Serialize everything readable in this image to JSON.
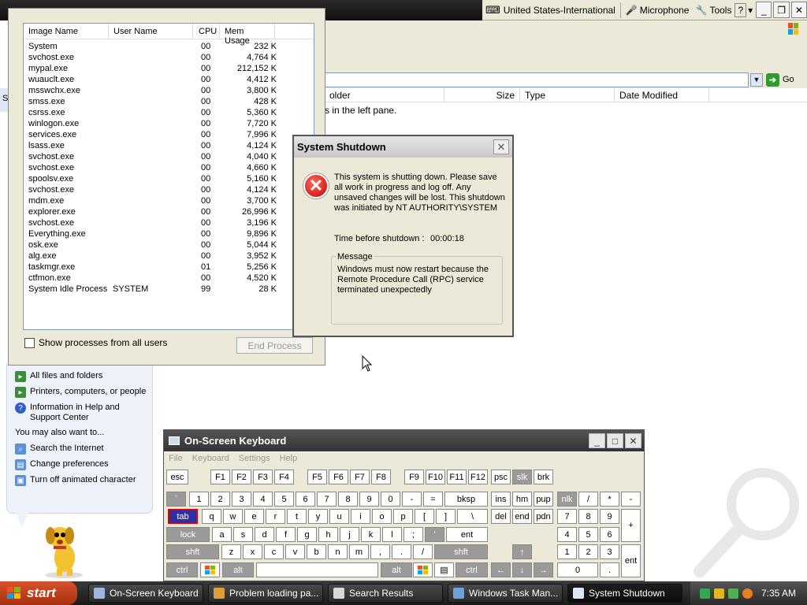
{
  "langbar": {
    "language": "United States-International",
    "microphone": "Microphone",
    "tools": "Tools",
    "help": "?"
  },
  "search_results": {
    "go_label": "Go",
    "columns": [
      "older",
      "Size",
      "Type",
      "Date Modified"
    ],
    "hint": "s in the left pane.",
    "left_letter": "S"
  },
  "assistant": {
    "items": [
      {
        "label": "All files and folders",
        "icon": "search-folder-icon"
      },
      {
        "label": "Printers, computers, or people",
        "icon": "printer-icon"
      },
      {
        "label": "Information in Help and Support Center",
        "icon": "help-icon"
      }
    ],
    "also_heading": "You may also want to...",
    "also_items": [
      {
        "label": "Search the Internet",
        "icon": "internet-search-icon"
      },
      {
        "label": "Change preferences",
        "icon": "preferences-icon"
      },
      {
        "label": "Turn off animated character",
        "icon": "character-icon"
      }
    ]
  },
  "task_manager": {
    "columns": [
      "Image Name",
      "User Name",
      "CPU",
      "Mem Usage"
    ],
    "rows": [
      {
        "name": "System",
        "user": "",
        "cpu": "00",
        "mem": "232 K"
      },
      {
        "name": "svchost.exe",
        "user": "",
        "cpu": "00",
        "mem": "4,764 K"
      },
      {
        "name": "mypal.exe",
        "user": "",
        "cpu": "00",
        "mem": "212,152 K"
      },
      {
        "name": "wuauclt.exe",
        "user": "",
        "cpu": "00",
        "mem": "4,412 K"
      },
      {
        "name": "msswchx.exe",
        "user": "",
        "cpu": "00",
        "mem": "3,800 K"
      },
      {
        "name": "smss.exe",
        "user": "",
        "cpu": "00",
        "mem": "428 K"
      },
      {
        "name": "csrss.exe",
        "user": "",
        "cpu": "00",
        "mem": "5,360 K"
      },
      {
        "name": "winlogon.exe",
        "user": "",
        "cpu": "00",
        "mem": "7,720 K"
      },
      {
        "name": "services.exe",
        "user": "",
        "cpu": "00",
        "mem": "7,996 K"
      },
      {
        "name": "lsass.exe",
        "user": "",
        "cpu": "00",
        "mem": "4,124 K"
      },
      {
        "name": "svchost.exe",
        "user": "",
        "cpu": "00",
        "mem": "4,040 K"
      },
      {
        "name": "svchost.exe",
        "user": "",
        "cpu": "00",
        "mem": "4,660 K"
      },
      {
        "name": "spoolsv.exe",
        "user": "",
        "cpu": "00",
        "mem": "5,160 K"
      },
      {
        "name": "svchost.exe",
        "user": "",
        "cpu": "00",
        "mem": "4,124 K"
      },
      {
        "name": "mdm.exe",
        "user": "",
        "cpu": "00",
        "mem": "3,700 K"
      },
      {
        "name": "explorer.exe",
        "user": "",
        "cpu": "00",
        "mem": "26,996 K"
      },
      {
        "name": "svchost.exe",
        "user": "",
        "cpu": "00",
        "mem": "3,196 K"
      },
      {
        "name": "Everything.exe",
        "user": "",
        "cpu": "00",
        "mem": "9,896 K"
      },
      {
        "name": "osk.exe",
        "user": "",
        "cpu": "00",
        "mem": "5,044 K"
      },
      {
        "name": "alg.exe",
        "user": "",
        "cpu": "00",
        "mem": "3,952 K"
      },
      {
        "name": "taskmgr.exe",
        "user": "",
        "cpu": "01",
        "mem": "5,256 K"
      },
      {
        "name": "ctfmon.exe",
        "user": "",
        "cpu": "00",
        "mem": "4,520 K"
      },
      {
        "name": "System Idle Process",
        "user": "SYSTEM",
        "cpu": "99",
        "mem": "28 K"
      }
    ],
    "show_all_label": "Show processes from all users",
    "end_process_label": "End Process"
  },
  "shutdown_dialog": {
    "title": "System Shutdown",
    "body": "This system is shutting down. Please save all work in progress and log off. Any unsaved changes will be lost. This shutdown was initiated by NT AUTHORITY\\SYSTEM",
    "time_label": "Time before shutdown :",
    "time_value": "00:00:18",
    "message_label": "Message",
    "message_text": "Windows must now restart because the Remote Procedure Call (RPC) service terminated unexpectedly"
  },
  "osk": {
    "title": "On-Screen Keyboard",
    "menu": [
      "File",
      "Keyboard",
      "Settings",
      "Help"
    ],
    "keys": [
      [
        "esc",
        211,
        596,
        28,
        "n"
      ],
      [
        "F1",
        267,
        596,
        25,
        "n"
      ],
      [
        "F2",
        294,
        596,
        25,
        "n"
      ],
      [
        "F3",
        321,
        596,
        25,
        "n"
      ],
      [
        "F4",
        348,
        596,
        25,
        "n"
      ],
      [
        "F5",
        390,
        596,
        25,
        "n"
      ],
      [
        "F6",
        417,
        596,
        25,
        "n"
      ],
      [
        "F7",
        444,
        596,
        25,
        "n"
      ],
      [
        "F8",
        471,
        596,
        25,
        "n"
      ],
      [
        "F9",
        513,
        596,
        25,
        "n"
      ],
      [
        "F10",
        540,
        596,
        25,
        "n"
      ],
      [
        "F11",
        567,
        596,
        25,
        "n"
      ],
      [
        "F12",
        594,
        596,
        25,
        "n"
      ],
      [
        "psc",
        623,
        596,
        25,
        "n"
      ],
      [
        "slk",
        650,
        596,
        25,
        "dim"
      ],
      [
        "brk",
        677,
        596,
        25,
        "n"
      ],
      [
        "`",
        211,
        624,
        25,
        "dim"
      ],
      [
        "1",
        240,
        624,
        25,
        "n"
      ],
      [
        "2",
        267,
        624,
        25,
        "n"
      ],
      [
        "3",
        294,
        624,
        25,
        "n"
      ],
      [
        "4",
        321,
        624,
        25,
        "n"
      ],
      [
        "5",
        348,
        624,
        25,
        "n"
      ],
      [
        "6",
        375,
        624,
        25,
        "n"
      ],
      [
        "7",
        402,
        624,
        25,
        "n"
      ],
      [
        "8",
        429,
        624,
        25,
        "n"
      ],
      [
        "9",
        456,
        624,
        25,
        "n"
      ],
      [
        "0",
        483,
        624,
        25,
        "n"
      ],
      [
        "-",
        510,
        624,
        25,
        "n"
      ],
      [
        "=",
        537,
        624,
        25,
        "n"
      ],
      [
        "bksp",
        564,
        624,
        55,
        "n"
      ],
      [
        "ins",
        623,
        624,
        25,
        "n"
      ],
      [
        "hm",
        650,
        624,
        25,
        "n"
      ],
      [
        "pup",
        677,
        624,
        25,
        "n"
      ],
      [
        "nlk",
        707,
        624,
        25,
        "dim"
      ],
      [
        "/",
        734,
        624,
        25,
        "n"
      ],
      [
        "*",
        761,
        624,
        25,
        "n"
      ],
      [
        "-",
        788,
        624,
        25,
        "n"
      ],
      [
        "tab",
        213,
        646,
        38,
        "sel"
      ],
      [
        "q",
        256,
        646,
        25,
        "n"
      ],
      [
        "w",
        283,
        646,
        25,
        "n"
      ],
      [
        "e",
        310,
        646,
        25,
        "n"
      ],
      [
        "r",
        337,
        646,
        25,
        "n"
      ],
      [
        "t",
        364,
        646,
        25,
        "n"
      ],
      [
        "y",
        391,
        646,
        25,
        "n"
      ],
      [
        "u",
        418,
        646,
        25,
        "n"
      ],
      [
        "i",
        445,
        646,
        25,
        "n"
      ],
      [
        "o",
        472,
        646,
        25,
        "n"
      ],
      [
        "p",
        499,
        646,
        25,
        "n"
      ],
      [
        "[",
        526,
        646,
        25,
        "n"
      ],
      [
        "]",
        553,
        646,
        25,
        "n"
      ],
      [
        "\\",
        580,
        646,
        39,
        "n"
      ],
      [
        "del",
        623,
        646,
        25,
        "n"
      ],
      [
        "end",
        650,
        646,
        25,
        "n"
      ],
      [
        "pdn",
        677,
        646,
        25,
        "n"
      ],
      [
        "7",
        707,
        646,
        25,
        "n"
      ],
      [
        "8",
        734,
        646,
        25,
        "n"
      ],
      [
        "9",
        761,
        646,
        25,
        "n"
      ],
      [
        "lock",
        211,
        669,
        55,
        "dim"
      ],
      [
        "a",
        269,
        669,
        25,
        "n"
      ],
      [
        "s",
        296,
        669,
        25,
        "n"
      ],
      [
        "d",
        323,
        669,
        25,
        "n"
      ],
      [
        "f",
        350,
        669,
        25,
        "n"
      ],
      [
        "g",
        377,
        669,
        25,
        "n"
      ],
      [
        "h",
        404,
        669,
        25,
        "n"
      ],
      [
        "j",
        431,
        669,
        25,
        "n"
      ],
      [
        "k",
        458,
        669,
        25,
        "n"
      ],
      [
        "l",
        485,
        669,
        25,
        "n"
      ],
      [
        ";",
        512,
        669,
        25,
        "n"
      ],
      [
        "'",
        539,
        669,
        25,
        "dim"
      ],
      [
        "ent",
        566,
        669,
        53,
        "n"
      ],
      [
        "4",
        707,
        669,
        25,
        "n"
      ],
      [
        "5",
        734,
        669,
        25,
        "n"
      ],
      [
        "6",
        761,
        669,
        25,
        "n"
      ],
      [
        "shft",
        211,
        691,
        67,
        "dim"
      ],
      [
        "z",
        281,
        691,
        25,
        "n"
      ],
      [
        "x",
        308,
        691,
        25,
        "n"
      ],
      [
        "c",
        335,
        691,
        25,
        "n"
      ],
      [
        "v",
        362,
        691,
        25,
        "n"
      ],
      [
        "b",
        389,
        691,
        25,
        "n"
      ],
      [
        "n",
        416,
        691,
        25,
        "n"
      ],
      [
        "m",
        443,
        691,
        25,
        "n"
      ],
      [
        ",",
        470,
        691,
        25,
        "n"
      ],
      [
        ".",
        497,
        691,
        25,
        "n"
      ],
      [
        "/",
        524,
        691,
        25,
        "n"
      ],
      [
        "shft",
        551,
        691,
        68,
        "dim"
      ],
      [
        "↑",
        650,
        691,
        25,
        "dim"
      ],
      [
        "1",
        707,
        691,
        25,
        "n"
      ],
      [
        "2",
        734,
        691,
        25,
        "n"
      ],
      [
        "3",
        761,
        691,
        25,
        "n"
      ],
      [
        "ctrl",
        211,
        714,
        40,
        "dim"
      ],
      [
        "",
        254,
        714,
        25,
        "win"
      ],
      [
        "alt",
        282,
        714,
        40,
        "dim"
      ],
      [
        "",
        325,
        714,
        155,
        "n"
      ],
      [
        "alt",
        483,
        714,
        40,
        "dim"
      ],
      [
        "",
        524,
        714,
        25,
        "win"
      ],
      [
        "▤",
        551,
        714,
        25,
        "n"
      ],
      [
        "ctrl",
        578,
        714,
        41,
        "dim"
      ],
      [
        "←",
        623,
        714,
        25,
        "dim"
      ],
      [
        "↓",
        650,
        714,
        25,
        "dim"
      ],
      [
        "→",
        677,
        714,
        25,
        "dim"
      ],
      [
        "0",
        707,
        714,
        52,
        "n"
      ],
      [
        ".",
        761,
        714,
        25,
        "n"
      ]
    ],
    "plus_label": "+",
    "ent_label": "ent"
  },
  "taskbar": {
    "start": "start",
    "tasks": [
      {
        "label": "On-Screen Keyboard",
        "icon": "keyboard-icon",
        "active": false
      },
      {
        "label": "Problem loading pa...",
        "icon": "browser-icon",
        "active": false
      },
      {
        "label": "Search Results",
        "icon": "search-results-icon",
        "active": false
      },
      {
        "label": "Windows Task Man...",
        "icon": "task-manager-icon",
        "active": false
      },
      {
        "label": "System Shutdown",
        "icon": "window-icon",
        "active": true
      }
    ],
    "clock": "7:35 AM"
  },
  "colors": {
    "error_red": "#c40000",
    "tab_key": "#2f2fa0",
    "start_orange": "#d6522b"
  }
}
